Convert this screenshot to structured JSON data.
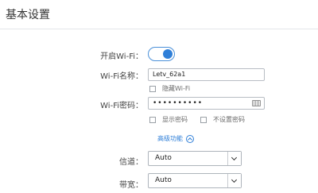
{
  "page": {
    "title": "基本设置"
  },
  "settings": {
    "wifi_toggle_label": "开启Wi-Fi：",
    "wifi_enabled": true,
    "wifi_name_label": "Wi-Fi名称：",
    "wifi_name_value": "Letv_62a1",
    "hide_wifi_label": "隐藏Wi-Fi",
    "wifi_password_label": "Wi-Fi密码：",
    "wifi_password_value": "••••••••••",
    "show_password_label": "显示密码",
    "no_password_label": "不设置密码",
    "advanced_label": "高级功能",
    "channel_label": "信道：",
    "channel_value": "Auto",
    "bandwidth_label": "带宽：",
    "bandwidth_value": "Auto"
  },
  "icons": {
    "toggle": "toggle-switch-icon",
    "keyboard": "keyboard-icon",
    "advanced_toggle": "chevron-up-circle-icon",
    "select_arrow": "chevron-down-icon"
  },
  "colors": {
    "accent": "#2f7fd8",
    "border": "#aeb4bb",
    "text": "#333333"
  }
}
